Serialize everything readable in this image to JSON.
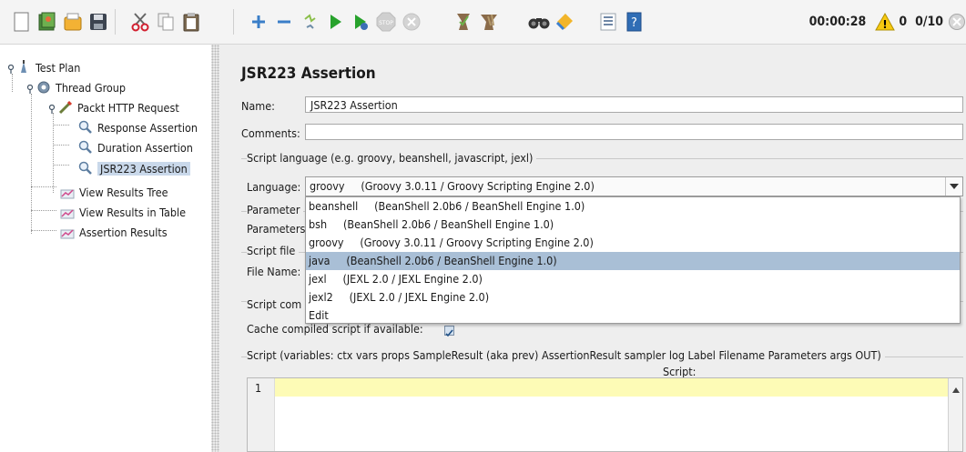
{
  "toolbar": {
    "items": [
      {
        "name": "new-icon"
      },
      {
        "name": "templates-icon"
      },
      {
        "name": "open-icon"
      },
      {
        "name": "save-icon"
      },
      {
        "name": "cut-icon"
      },
      {
        "name": "copy-icon"
      },
      {
        "name": "paste-icon"
      },
      {
        "name": "expand-icon"
      },
      {
        "name": "collapse-icon"
      },
      {
        "name": "toggle-icon"
      },
      {
        "name": "start-icon"
      },
      {
        "name": "start-no-pauses-icon"
      },
      {
        "name": "stop-icon"
      },
      {
        "name": "shutdown-icon"
      },
      {
        "name": "clear-icon"
      },
      {
        "name": "clear-all-icon"
      },
      {
        "name": "search-icon"
      },
      {
        "name": "reset-search-icon"
      },
      {
        "name": "function-helper-icon"
      },
      {
        "name": "help-icon"
      }
    ],
    "stop_label": "STOP",
    "elapsed_time": "00:00:28",
    "warning_count": "0",
    "threads": "0/10"
  },
  "tree": {
    "nodes": [
      {
        "label": "Test Plan",
        "icon": "test-plan-icon"
      },
      {
        "label": "Thread Group",
        "icon": "thread-group-icon"
      },
      {
        "label": "Packt HTTP Request",
        "icon": "http-sampler-icon"
      },
      {
        "label": "Response Assertion",
        "icon": "assertion-icon"
      },
      {
        "label": "Duration Assertion",
        "icon": "assertion-icon"
      },
      {
        "label": "JSR223 Assertion",
        "icon": "assertion-icon",
        "selected": true
      },
      {
        "label": "View Results Tree",
        "icon": "listener-icon"
      },
      {
        "label": "View Results in Table",
        "icon": "listener-icon"
      },
      {
        "label": "Assertion Results",
        "icon": "listener-icon"
      }
    ]
  },
  "panel": {
    "title": "JSR223 Assertion",
    "name_label": "Name:",
    "name_value": "JSR223 Assertion",
    "comments_label": "Comments:",
    "comments_value": "",
    "script_language_group": "Script language (e.g. groovy, beanshell, javascript, jexl)",
    "language_label": "Language:",
    "language_selected": "groovy     (Groovy 3.0.11 / Groovy Scripting Engine 2.0)",
    "parameters_group": "Parameter",
    "parameters_label": "Parameters",
    "script_file_group": "Script file",
    "file_name_label": "File Name:",
    "script_compilation_group": "Script com",
    "cache_label": "Cache compiled script if available:",
    "script_group": "Script (variables: ctx vars props SampleResult (aka prev) AssertionResult sampler log Label Filename Parameters args OUT)",
    "script_label": "Script:",
    "line_number": "1"
  },
  "dropdown": {
    "options": [
      {
        "text": "beanshell     (BeanShell 2.0b6 / BeanShell Engine 1.0)",
        "highlighted": false
      },
      {
        "text": "bsh     (BeanShell 2.0b6 / BeanShell Engine 1.0)",
        "highlighted": false
      },
      {
        "text": "groovy     (Groovy 3.0.11 / Groovy Scripting Engine 2.0)",
        "highlighted": false
      },
      {
        "text": "java     (BeanShell 2.0b6 / BeanShell Engine 1.0)",
        "highlighted": true
      },
      {
        "text": "jexl     (JEXL 2.0 / JEXL Engine 2.0)",
        "highlighted": false
      },
      {
        "text": "jexl2     (JEXL 2.0 / JEXL Engine 2.0)",
        "highlighted": false
      },
      {
        "text": "Edit",
        "highlighted": false
      }
    ]
  },
  "colors": {
    "selection": "#c9d8ea",
    "dropdown_highlight": "#a9bfd6",
    "current_line": "#fdfbb6",
    "panel_bg": "#eeeeee"
  }
}
